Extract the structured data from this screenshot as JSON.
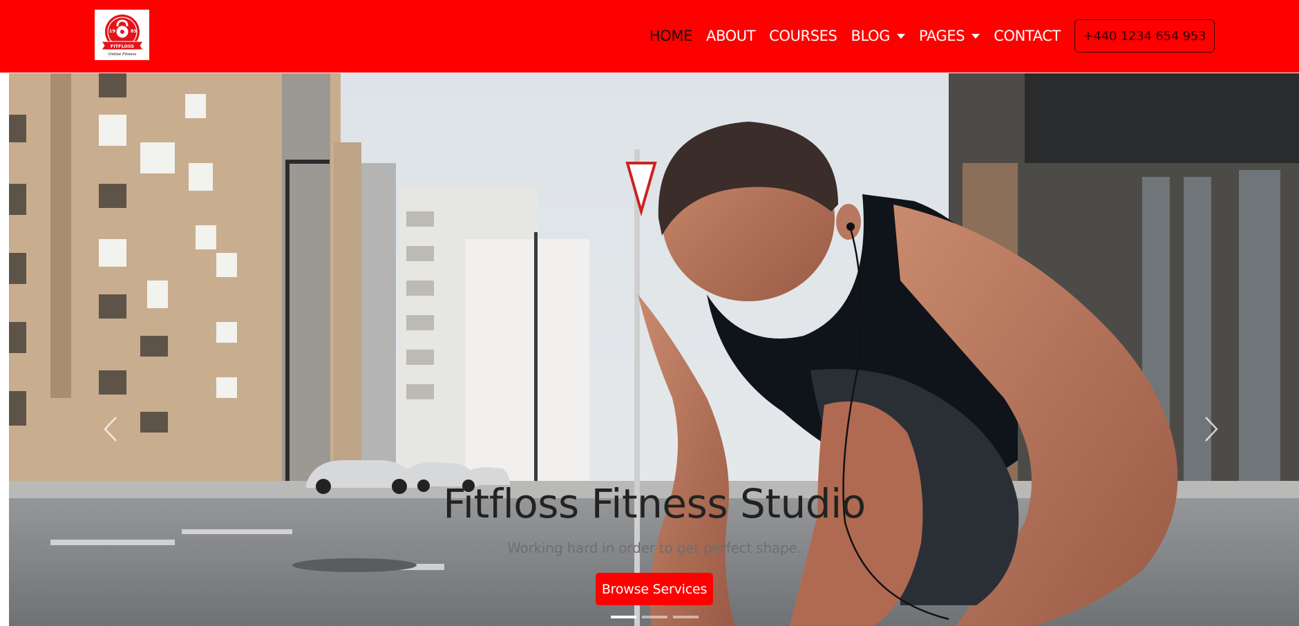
{
  "brand": {
    "name": "FITFLOSS",
    "logo_year_left": "19",
    "logo_year_right": "85",
    "logo_script": "Online Fitness",
    "accent_color": "#ff0000"
  },
  "nav": {
    "items": [
      {
        "label": "HOME",
        "active": true,
        "dropdown": false
      },
      {
        "label": "ABOUT",
        "active": false,
        "dropdown": false
      },
      {
        "label": "COURSES",
        "active": false,
        "dropdown": false
      },
      {
        "label": "BLOG",
        "active": false,
        "dropdown": true
      },
      {
        "label": "PAGES",
        "active": false,
        "dropdown": true
      },
      {
        "label": "CONTACT",
        "active": false,
        "dropdown": false
      }
    ],
    "phone": "+440 1234 654 953"
  },
  "hero": {
    "title": "Fitfloss Fitness Studio",
    "subtitle": "Working hard in order to get perfect shape.",
    "cta_label": "Browse Services",
    "prev_icon": "chevron-left-icon",
    "next_icon": "chevron-right-icon",
    "slide_count": 3,
    "active_slide": 1
  }
}
